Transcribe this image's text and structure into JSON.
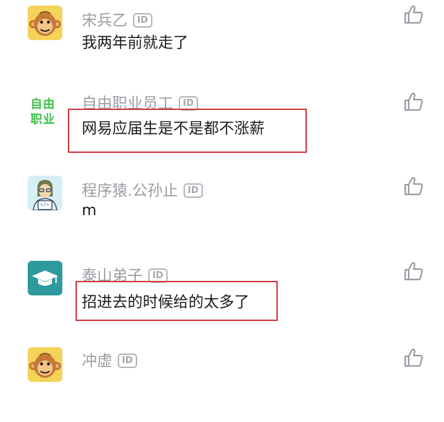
{
  "comments": [
    {
      "name": "宋兵乙",
      "id_badge": "ID",
      "text": "我两年前就走了",
      "avatar": "monkey-avatar",
      "highlighted": false
    },
    {
      "name": "自由职业员工",
      "id_badge": "ID",
      "text": "网易应届生是不是都不涨薪",
      "avatar": "freelance-avatar",
      "avatar_text_top": "自由",
      "avatar_text_bottom": "职业",
      "highlighted": true
    },
    {
      "name": "程序猿.公孙止",
      "id_badge": "ID",
      "text": "m",
      "avatar": "programmer-avatar",
      "avatar_code": "</>",
      "highlighted": false
    },
    {
      "name": "泰山弟子",
      "id_badge": "ID",
      "text": "招进去的时候给的太多了",
      "avatar": "graduation-cap-avatar",
      "highlighted": true
    },
    {
      "name": "冲虚",
      "id_badge": "ID",
      "text": "",
      "avatar": "monkey-avatar",
      "highlighted": false
    }
  ],
  "colors": {
    "name": "#9b9ba3",
    "text": "#1d1d1f",
    "highlight": "#d23a3f",
    "freelance_green": "#3fbf4a",
    "teal": "#2f9a9d"
  }
}
